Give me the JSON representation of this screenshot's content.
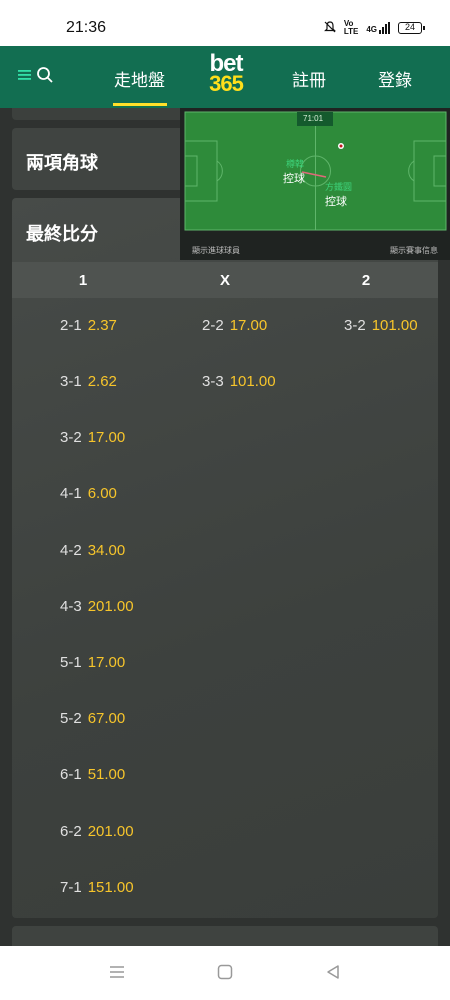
{
  "status": {
    "time": "21:36",
    "battery": "24",
    "network": "4G"
  },
  "header": {
    "nav_live": "走地盤",
    "logo_top": "bet",
    "logo_bottom": "365",
    "nav_register": "註冊",
    "nav_login": "登錄",
    "brand_color": "#126e51",
    "accent_color": "#ffdf1b"
  },
  "markets": {
    "corners_title": "兩項角球",
    "score_title": "最終比分",
    "columns": [
      "1",
      "X",
      "2"
    ],
    "home": [
      {
        "score": "2-1",
        "price": "2.37"
      },
      {
        "score": "3-1",
        "price": "2.62"
      },
      {
        "score": "3-2",
        "price": "17.00"
      },
      {
        "score": "4-1",
        "price": "6.00"
      },
      {
        "score": "4-2",
        "price": "34.00"
      },
      {
        "score": "4-3",
        "price": "201.00"
      },
      {
        "score": "5-1",
        "price": "17.00"
      },
      {
        "score": "5-2",
        "price": "67.00"
      },
      {
        "score": "6-1",
        "price": "51.00"
      },
      {
        "score": "6-2",
        "price": "201.00"
      },
      {
        "score": "7-1",
        "price": "151.00"
      }
    ],
    "draw": [
      {
        "score": "2-2",
        "price": "17.00"
      },
      {
        "score": "3-3",
        "price": "101.00"
      }
    ],
    "away": [
      {
        "score": "3-2",
        "price": "101.00"
      }
    ]
  },
  "tracker": {
    "clock": "71:01",
    "team_a_name": "樽韓",
    "team_a_status": "控球",
    "team_b_name": "方鐵圓",
    "team_b_status": "控球",
    "note_left": "顯示進球球員",
    "note_right": "顯示賽事信息"
  }
}
